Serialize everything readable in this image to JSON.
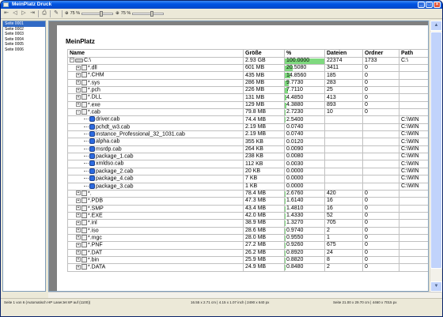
{
  "window": {
    "title": "MeinPlatz Druck",
    "minimize": "_",
    "maximize": "□",
    "close": "×"
  },
  "toolbar": {
    "zoom1": "75 %",
    "zoom2": "75 %"
  },
  "sidebar": {
    "items": [
      "Seite 0001",
      "Seite 0002",
      "Seite 0003",
      "Seite 0004",
      "Seite 0005",
      "Seite 0006"
    ]
  },
  "page": {
    "title": "MeinPlatz"
  },
  "table": {
    "headers": [
      "Name",
      "Größe",
      "%",
      "Dateien",
      "Ordner",
      "Path"
    ],
    "rows": [
      {
        "name": "C:\\",
        "size": "2.93 GB",
        "pct": "100.0000",
        "pctv": 100,
        "files": "22374",
        "folders": "1733",
        "path": "C:\\",
        "indent": 0,
        "icon": "drive",
        "exp": "−"
      },
      {
        "name": "*.dll",
        "size": "601 MB",
        "pct": "20.5080",
        "pctv": 20.508,
        "files": "3411",
        "folders": "0",
        "path": "",
        "indent": 1,
        "icon": "file",
        "exp": "+"
      },
      {
        "name": "*.CHM",
        "size": "435 MB",
        "pct": "14.8560",
        "pctv": 14.856,
        "files": "185",
        "folders": "0",
        "path": "",
        "indent": 1,
        "icon": "file",
        "exp": "+"
      },
      {
        "name": "*.sys",
        "size": "286 MB",
        "pct": "9.7730",
        "pctv": 9.773,
        "files": "283",
        "folders": "0",
        "path": "",
        "indent": 1,
        "icon": "file",
        "exp": "+"
      },
      {
        "name": "*.pch",
        "size": "226 MB",
        "pct": "7.7110",
        "pctv": 7.711,
        "files": "25",
        "folders": "0",
        "path": "",
        "indent": 1,
        "icon": "file",
        "exp": "+"
      },
      {
        "name": "*.DLL",
        "size": "131 MB",
        "pct": "4.4850",
        "pctv": 4.485,
        "files": "413",
        "folders": "0",
        "path": "",
        "indent": 1,
        "icon": "file",
        "exp": "+"
      },
      {
        "name": "*.exe",
        "size": "129 MB",
        "pct": "4.3880",
        "pctv": 4.388,
        "files": "893",
        "folders": "0",
        "path": "",
        "indent": 1,
        "icon": "file",
        "exp": "+"
      },
      {
        "name": "*.cab",
        "size": "79.8 MB",
        "pct": "2.7230",
        "pctv": 2.723,
        "files": "10",
        "folders": "0",
        "path": "",
        "indent": 1,
        "icon": "file",
        "exp": "−"
      },
      {
        "name": "driver.cab",
        "size": "74.4 MB",
        "pct": "2.5400",
        "pctv": 2.54,
        "files": "",
        "folders": "",
        "path": "C:\\WIN",
        "indent": 2,
        "icon": "cab",
        "exp": ""
      },
      {
        "name": "pchdt_w3.cab",
        "size": "2.19 MB",
        "pct": "0.0740",
        "pctv": 0.074,
        "files": "",
        "folders": "",
        "path": "C:\\WIN",
        "indent": 2,
        "icon": "cab",
        "exp": ""
      },
      {
        "name": "instance_Professional_32_1031.cab",
        "size": "2.19 MB",
        "pct": "0.0740",
        "pctv": 0.074,
        "files": "",
        "folders": "",
        "path": "C:\\WIN",
        "indent": 2,
        "icon": "cab",
        "exp": ""
      },
      {
        "name": "alpha.cab",
        "size": "355 KB",
        "pct": "0.0120",
        "pctv": 0.012,
        "files": "",
        "folders": "",
        "path": "C:\\WIN",
        "indent": 2,
        "icon": "cab",
        "exp": ""
      },
      {
        "name": "msrdp.cab",
        "size": "264 KB",
        "pct": "0.0090",
        "pctv": 0.009,
        "files": "",
        "folders": "",
        "path": "C:\\WIN",
        "indent": 2,
        "icon": "cab",
        "exp": ""
      },
      {
        "name": "package_1.cab",
        "size": "238 KB",
        "pct": "0.0080",
        "pctv": 0.008,
        "files": "",
        "folders": "",
        "path": "C:\\WIN",
        "indent": 2,
        "icon": "cab",
        "exp": ""
      },
      {
        "name": "xmldso.cab",
        "size": "112 KB",
        "pct": "0.0030",
        "pctv": 0.003,
        "files": "",
        "folders": "",
        "path": "C:\\WIN",
        "indent": 2,
        "icon": "cab",
        "exp": ""
      },
      {
        "name": "package_2.cab",
        "size": "20 KB",
        "pct": "0.0000",
        "pctv": 0,
        "files": "",
        "folders": "",
        "path": "C:\\WIN",
        "indent": 2,
        "icon": "cab",
        "exp": ""
      },
      {
        "name": "package_4.cab",
        "size": "7 KB",
        "pct": "0.0000",
        "pctv": 0,
        "files": "",
        "folders": "",
        "path": "C:\\WIN",
        "indent": 2,
        "icon": "cab",
        "exp": ""
      },
      {
        "name": "package_3.cab",
        "size": "1 KB",
        "pct": "0.0000",
        "pctv": 0,
        "files": "",
        "folders": "",
        "path": "C:\\WIN",
        "indent": 2,
        "icon": "cab",
        "exp": ""
      },
      {
        "name": "*.",
        "size": "78.4 MB",
        "pct": "2.6760",
        "pctv": 2.676,
        "files": "420",
        "folders": "0",
        "path": "",
        "indent": 1,
        "icon": "file",
        "exp": "+"
      },
      {
        "name": "*.PDB",
        "size": "47.3 MB",
        "pct": "1.6140",
        "pctv": 1.614,
        "files": "16",
        "folders": "0",
        "path": "",
        "indent": 1,
        "icon": "file",
        "exp": "+"
      },
      {
        "name": "*.SMP",
        "size": "43.4 MB",
        "pct": "1.4810",
        "pctv": 1.481,
        "files": "16",
        "folders": "0",
        "path": "",
        "indent": 1,
        "icon": "file",
        "exp": "+"
      },
      {
        "name": "*.EXE",
        "size": "42.0 MB",
        "pct": "1.4330",
        "pctv": 1.433,
        "files": "52",
        "folders": "0",
        "path": "",
        "indent": 1,
        "icon": "file",
        "exp": "+"
      },
      {
        "name": "*.inl",
        "size": "38.9 MB",
        "pct": "1.3270",
        "pctv": 1.327,
        "files": "705",
        "folders": "0",
        "path": "",
        "indent": 1,
        "icon": "file",
        "exp": "+"
      },
      {
        "name": "*.iso",
        "size": "28.6 MB",
        "pct": "0.9740",
        "pctv": 0.974,
        "files": "2",
        "folders": "0",
        "path": "",
        "indent": 1,
        "icon": "file",
        "exp": "+"
      },
      {
        "name": "*.mgc",
        "size": "28.0 MB",
        "pct": "0.9550",
        "pctv": 0.955,
        "files": "1",
        "folders": "0",
        "path": "",
        "indent": 1,
        "icon": "file",
        "exp": "+"
      },
      {
        "name": "*.PNF",
        "size": "27.2 MB",
        "pct": "0.9260",
        "pctv": 0.926,
        "files": "675",
        "folders": "0",
        "path": "",
        "indent": 1,
        "icon": "file",
        "exp": "+"
      },
      {
        "name": "*.DAT",
        "size": "26.2 MB",
        "pct": "0.8920",
        "pctv": 0.892,
        "files": "24",
        "folders": "0",
        "path": "",
        "indent": 1,
        "icon": "file",
        "exp": "+"
      },
      {
        "name": "*.bin",
        "size": "25.9 MB",
        "pct": "0.8820",
        "pctv": 0.882,
        "files": "8",
        "folders": "0",
        "path": "",
        "indent": 1,
        "icon": "file",
        "exp": "+"
      },
      {
        "name": "*.DATA",
        "size": "24.9 MB",
        "pct": "0.8480",
        "pctv": 0.848,
        "files": "2",
        "folders": "0",
        "path": "",
        "indent": 1,
        "icon": "file",
        "exp": "+"
      }
    ]
  },
  "statusbar": {
    "left": "Seite 1 von 6 (Automatisch HP LaserJet 6P auf (1100))",
    "mid": "16.55 x 2.71 cm | 4.15 x 1.07 inch | 2490 x 640 px",
    "right": "Seite 21.00 x 29.70 cm | 4460 x 7015 px"
  }
}
